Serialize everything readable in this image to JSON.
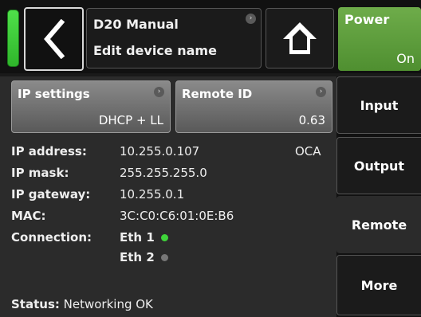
{
  "header": {
    "title_line1": "D20 Manual",
    "title_line2": "Edit device name",
    "power_label": "Power",
    "power_value": "On",
    "status_led_color": "#3fd43a"
  },
  "icons": {
    "back": "back-arrow-icon",
    "home": "home-icon",
    "more_indicator": "chevron-right-icon"
  },
  "buttons": {
    "ip_settings": {
      "label": "IP settings",
      "value": "DHCP + LL"
    },
    "remote_id": {
      "label": "Remote ID",
      "value": "0.63"
    }
  },
  "info": {
    "ip_address_label": "IP address:",
    "ip_address_value": "10.255.0.107",
    "protocol": "OCA",
    "ip_mask_label": "IP mask:",
    "ip_mask_value": "255.255.255.0",
    "ip_gateway_label": "IP gateway:",
    "ip_gateway_value": "10.255.0.1",
    "mac_label": "MAC:",
    "mac_value": "3C:C0:C6:01:0E:B6",
    "connection_label": "Connection:",
    "eth1_label": "Eth 1",
    "eth1_color": "#3fd43a",
    "eth2_label": "Eth 2",
    "eth2_color": "#777777",
    "status_label": "Status:",
    "status_value": "Networking OK"
  },
  "tabs": [
    "Input",
    "Output",
    "Remote",
    "More"
  ]
}
